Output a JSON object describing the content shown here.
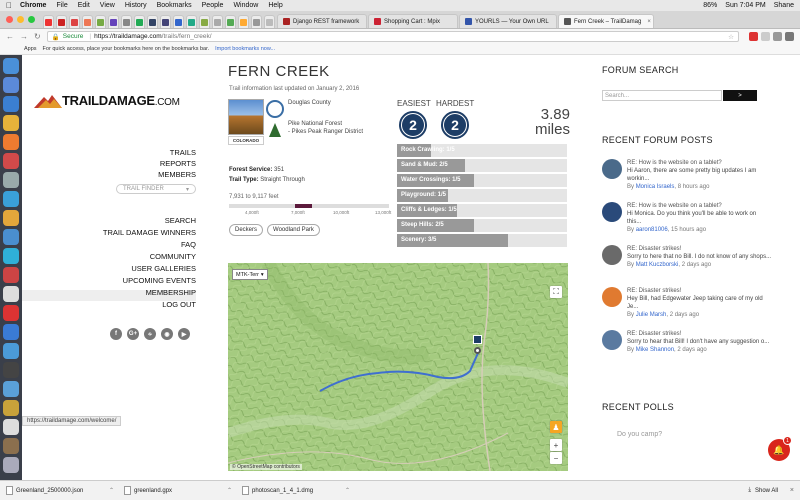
{
  "menubar": {
    "app": "Chrome",
    "items": [
      "File",
      "Edit",
      "View",
      "History",
      "Bookmarks",
      "People",
      "Window",
      "Help"
    ],
    "battery": "86%",
    "clock": "Sun 7:04 PM",
    "user": "Shane"
  },
  "tabs": [
    {
      "title": "Django REST framework",
      "color": "#aa2222"
    },
    {
      "title": "Shopping Cart : Mpix",
      "color": "#cc2233"
    },
    {
      "title": "YOURLS — Your Own URL",
      "color": "#3355aa"
    },
    {
      "title": "Fern Creek – TrailDamag",
      "color": "#555555"
    }
  ],
  "omnibox": {
    "secure_label": "Secure",
    "domain": "https://traildamage.com",
    "path": "/trails/fern_creek/"
  },
  "bookmarks": {
    "apps": "Apps",
    "hint": "For quick access, place your bookmarks here on the bookmarks bar.",
    "import": "Import bookmarks now..."
  },
  "logo": {
    "word": "TRAILDAMAGE",
    "suffix": ".COM"
  },
  "leftnav": {
    "top": [
      "TRAILS",
      "REPORTS",
      "MEMBERS"
    ],
    "trail_finder": "TRAIL FINDER",
    "links": [
      "SEARCH",
      "TRAIL DAMAGE WINNERS",
      "FAQ",
      "COMMUNITY",
      "USER GALLERIES",
      "UPCOMING EVENTS",
      "MEMBERSHIP",
      "LOG OUT"
    ],
    "social": [
      "f",
      "G+",
      "rss",
      "g",
      "yt"
    ]
  },
  "trail": {
    "title": "FERN CREEK",
    "updated": "Trail information last updated on January 2, 2016",
    "state_label": "COLORADO",
    "county": "Douglas County",
    "forest": "Pike National Forest",
    "district": "- Pikes Peak Ranger District",
    "easiest_label": "EASIEST",
    "hardest_label": "HARDEST",
    "easiest": "2",
    "hardest": "2",
    "miles_value": "3.89",
    "miles_label": "miles",
    "forest_service_label": "Forest Service:",
    "forest_service": "351",
    "trail_type_label": "Trail Type:",
    "trail_type": "Straight Through",
    "elevation": "7,931 to 9,117 feet",
    "elev_ticks": [
      "4,000ft",
      "7,000ft",
      "10,000ft",
      "13,000ft"
    ],
    "elev_range_pct": [
      0.41,
      0.52
    ],
    "chips": [
      "Deckers",
      "Woodland Park"
    ]
  },
  "ratings": [
    {
      "label": "Rock Crawling: 1/5",
      "fraction": 0.2
    },
    {
      "label": "Sand & Mud: 2/5",
      "fraction": 0.4
    },
    {
      "label": "Water Crossings: 1/5",
      "fraction": 0.45
    },
    {
      "label": "Playground: 1/5",
      "fraction": 0.3
    },
    {
      "label": "Cliffs & Ledges: 1/5",
      "fraction": 0.35
    },
    {
      "label": "Steep Hills: 2/5",
      "fraction": 0.45
    },
    {
      "label": "Scenery: 3/5",
      "fraction": 0.65
    }
  ],
  "map": {
    "type_label": "MTK-Terr",
    "attribution": "© OpenStreetMap contributors",
    "zoom_in": "+",
    "zoom_out": "−"
  },
  "forum": {
    "search_title": "FORUM SEARCH",
    "search_placeholder": "Search...",
    "search_button": ">",
    "recent_title": "RECENT FORUM POSTS",
    "posts": [
      {
        "title": "RE: How is the website on a tablet?",
        "text": "Hi Aaron, there are some pretty big updates I am workin...",
        "by": "By",
        "user": "Monica Israels",
        "ago": ", 8 hours ago",
        "color": "#4a6a8a"
      },
      {
        "title": "RE: How is the website on a tablet?",
        "text": "Hi Monica.  Do you think you'll be able to work on this...",
        "by": "By",
        "user": "aaron81006",
        "ago": ", 15 hours ago",
        "color": "#2a4a7a"
      },
      {
        "title": "RE: Disaster strikes!",
        "text": "Sorry to here that no Bill. I do not know of any shops...",
        "by": "By",
        "user": "Matt Kuczborski",
        "ago": ", 2 days ago",
        "color": "#6a6a6a"
      },
      {
        "title": "RE: Disaster strikes!",
        "text": "Hey Bill, had Edgewater Jeep taking care of my old Je...",
        "by": "By",
        "user": "Julie Marsh",
        "ago": ", 2 days ago",
        "color": "#e07a30"
      },
      {
        "title": "RE: Disaster strikes!",
        "text": "Sorry to hear that Bill!  I don't have any suggestion o...",
        "by": "By",
        "user": "Mike Shannon",
        "ago": ", 2 days ago",
        "color": "#5a7aa0"
      }
    ],
    "polls_title": "RECENT POLLS",
    "poll_question": "Do you camp?",
    "notif_count": "1"
  },
  "status_url": "https://traildamage.com/welcome/",
  "downloads": [
    "Greenland_2500000.json",
    "greenland.gpx",
    "photoscan_1_4_1.dmg"
  ],
  "show_all": "Show All"
}
